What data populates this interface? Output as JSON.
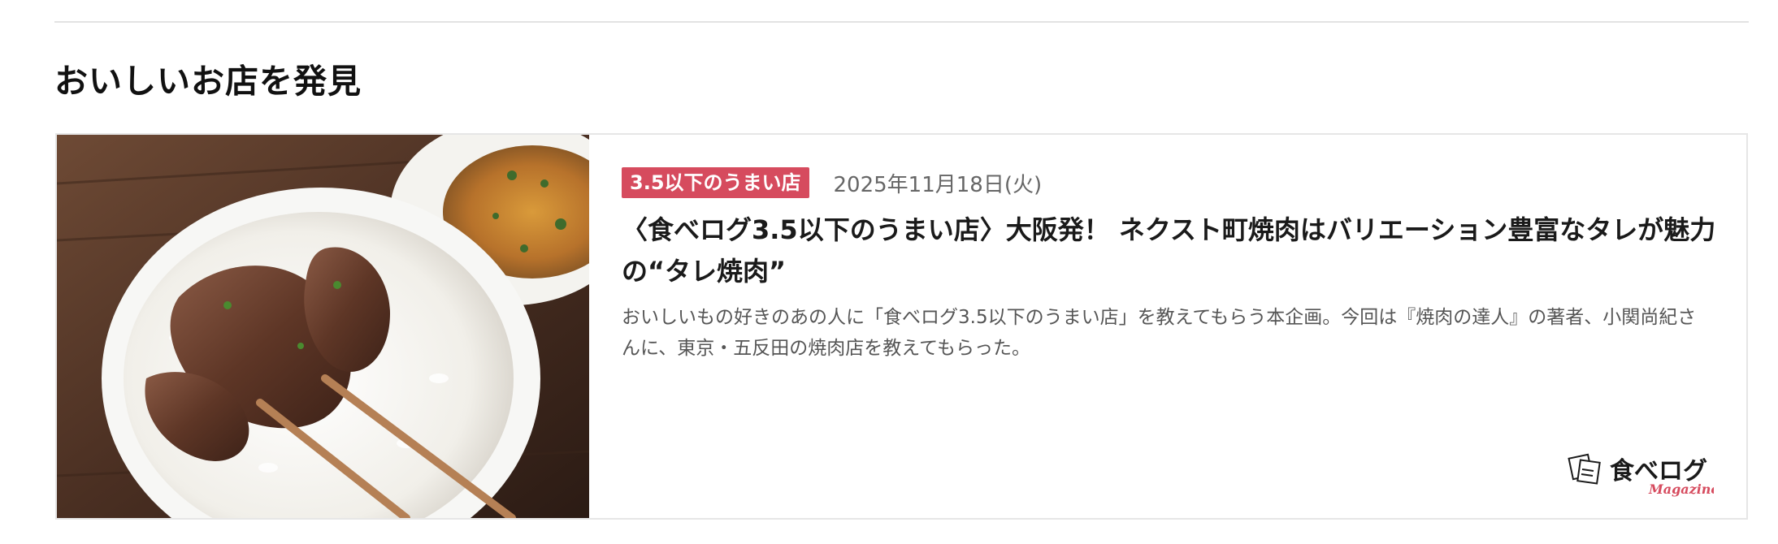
{
  "section": {
    "title": "おいしいお店を発見"
  },
  "article": {
    "badge": "3.5以下のうまい店",
    "date": "2025年11月18日(火)",
    "title": "〈食べログ3.5以下のうまい店〉大阪発！ ネクスト町焼肉はバリエーション豊富なタレが魅力の“タレ焼肉”",
    "excerpt": "おいしいもの好きのあの人に「食べログ3.5以下のうまい店」を教えてもらう本企画。今回は『焼肉の達人』の著者、小関尚紀さんに、東京・五反田の焼肉店を教えてもらった。",
    "image_icon": "food-photo-yakiniku-rice",
    "brand": {
      "name": "食べログ",
      "sub": "Magazine",
      "icon": "tabelog-magazine-logo"
    }
  },
  "colors": {
    "badge_bg": "#d64b5e",
    "brand_accent": "#d64b5e",
    "divider": "#e3e3e3",
    "text_primary": "#1a1a1a",
    "text_secondary": "#666666"
  }
}
